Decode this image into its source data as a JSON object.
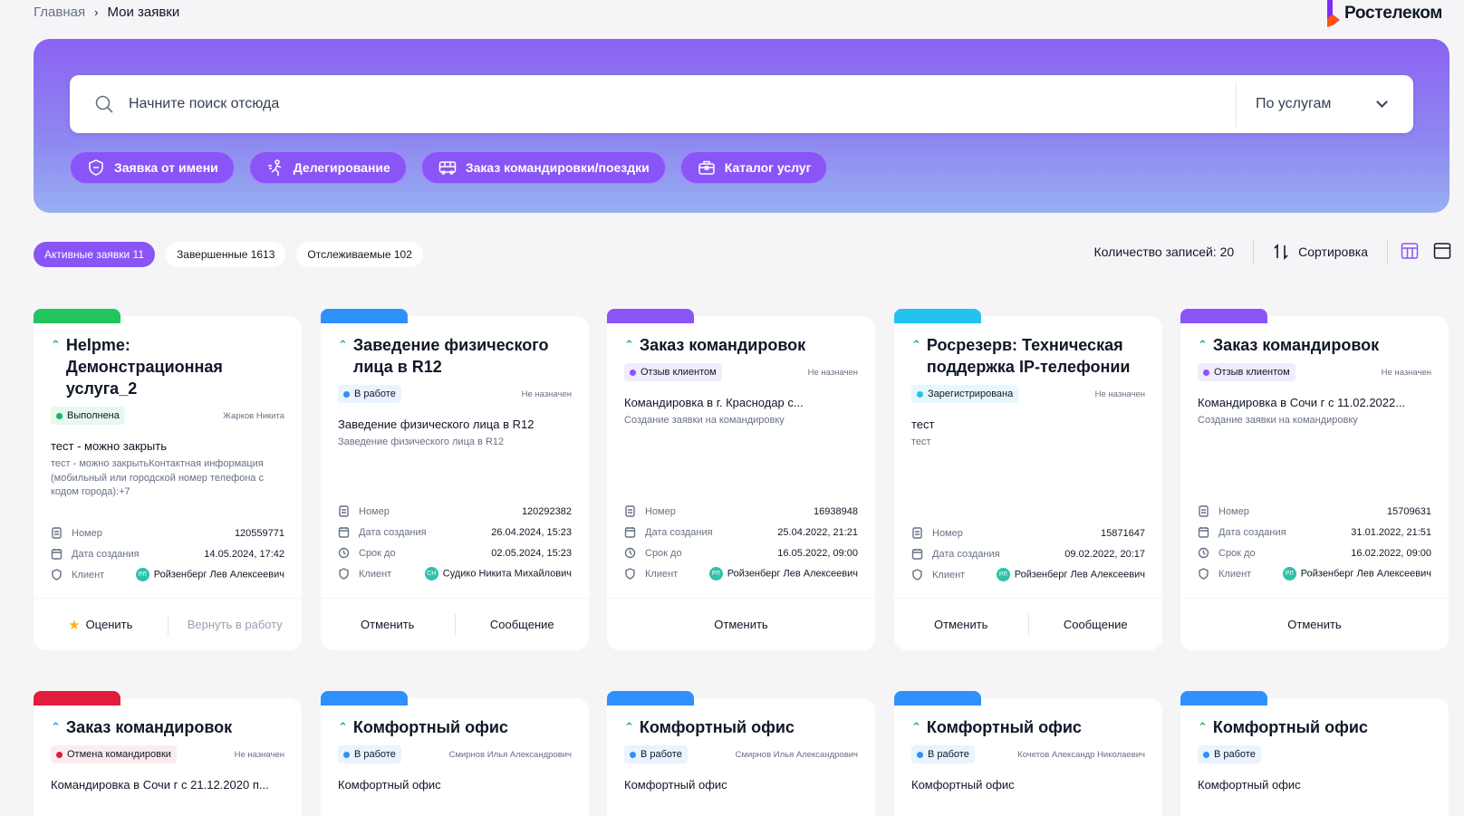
{
  "breadcrumb": {
    "home": "Главная",
    "current": "Мои заявки"
  },
  "logo": {
    "text": "Ростелеком"
  },
  "search": {
    "placeholder": "Начните поиск отсюда",
    "scope": "По услугам"
  },
  "actions": [
    {
      "label": "Заявка от имени",
      "icon": "shield-icon"
    },
    {
      "label": "Делегирование",
      "icon": "delegate-icon"
    },
    {
      "label": "Заказ командировки/поездки",
      "icon": "bus-icon"
    },
    {
      "label": "Каталог услуг",
      "icon": "briefcase-icon"
    }
  ],
  "tabs": [
    {
      "label": "Активные заявки 11",
      "active": true
    },
    {
      "label": "Завершенные 1613",
      "active": false
    },
    {
      "label": "Отслеживаемые 102",
      "active": false
    }
  ],
  "toolbar": {
    "count": "Количество записей: 20",
    "sort": "Сортировка"
  },
  "field_labels": {
    "number": "Номер",
    "created": "Дата создания",
    "due": "Срок до",
    "client": "Клиент"
  },
  "cards": [
    {
      "title": "Helpme: Демонстрационная услуга_2",
      "accent": "#22c55e",
      "status": "Выполнена",
      "status_color": "#12b76a",
      "status_bg": "#e7f8ee",
      "assignee": "Жарков Никита",
      "desc_title": "тест - можно закрыть",
      "desc_sub": "тест - можно закрытьКонтактная информация (мобильный или городской номер телефона с кодом города):+7",
      "number": "120559771",
      "created": "14.05.2024, 17:42",
      "due": "",
      "client_initials": "РЛ",
      "client": "Ройзенберг Лев Алексеевич",
      "buttons": [
        "Оценить",
        "Вернуть в работу"
      ]
    },
    {
      "title": "Заведение физического лица в R12",
      "accent": "#2e90fa",
      "status": "В работе",
      "status_color": "#2e90fa",
      "status_bg": "#eaf3fe",
      "assignee": "Не назначен",
      "desc_title": "Заведение физического лица в R12",
      "desc_sub": "Заведение физического лица в R12",
      "number": "120292382",
      "created": "26.04.2024, 15:23",
      "due": "02.05.2024, 15:23",
      "client_initials": "СН",
      "client": "Судико Никита Михайлович",
      "buttons": [
        "Отменить",
        "Сообщение"
      ]
    },
    {
      "title": "Заказ командировок",
      "accent": "#8a55f7",
      "status": "Отзыв клиентом",
      "status_color": "#8a55f7",
      "status_bg": "#f1ebfe",
      "assignee": "Не назначен",
      "desc_title": "Командировка в г. Краснодар с...",
      "desc_sub": "Создание заявки на командировку",
      "number": "16938948",
      "created": "25.04.2022, 21:21",
      "due": "16.05.2022, 09:00",
      "client_initials": "РЛ",
      "client": "Ройзенберг Лев Алексеевич",
      "buttons": [
        "Отменить"
      ]
    },
    {
      "title": "Росрезерв: Техническая поддержка IP-телефонии",
      "accent": "#22c3ee",
      "status": "Зарегистрирована",
      "status_color": "#22c3ee",
      "status_bg": "#e6f8fd",
      "assignee": "Не назначен",
      "desc_title": "тест",
      "desc_sub": "тест",
      "number": "15871647",
      "created": "09.02.2022, 20:17",
      "due": "",
      "client_initials": "РЛ",
      "client": "Ройзенберг Лев Алексеевич",
      "buttons": [
        "Отменить",
        "Сообщение"
      ]
    },
    {
      "title": "Заказ командировок",
      "accent": "#8a55f7",
      "status": "Отзыв клиентом",
      "status_color": "#8a55f7",
      "status_bg": "#f1ebfe",
      "assignee": "Не назначен",
      "desc_title": "Командировка в Сочи г с 11.02.2022...",
      "desc_sub": "Создание заявки на командировку",
      "number": "15709631",
      "created": "31.01.2022, 21:51",
      "due": "16.02.2022, 09:00",
      "client_initials": "РЛ",
      "client": "Ройзенберг Лев Алексеевич",
      "buttons": [
        "Отменить"
      ]
    },
    {
      "title": "Заказ командировок",
      "accent": "#e31b3c",
      "status": "Отмена командировки",
      "status_color": "#e31b3c",
      "status_bg": "#fdecee",
      "assignee": "Не назначен",
      "desc_title": "Командировка в Сочи г с 21.12.2020 п...",
      "priority_low": true
    },
    {
      "title": "Комфортный офис",
      "accent": "#2e90fa",
      "status": "В работе",
      "status_color": "#2e90fa",
      "status_bg": "#eaf3fe",
      "assignee": "Смирнов Илья Александрович",
      "desc_title": "Комфортный офис"
    },
    {
      "title": "Комфортный офис",
      "accent": "#2e90fa",
      "status": "В работе",
      "status_color": "#2e90fa",
      "status_bg": "#eaf3fe",
      "assignee": "Смирнов Илья Александрович",
      "desc_title": "Комфортный офис"
    },
    {
      "title": "Комфортный офис",
      "accent": "#2e90fa",
      "status": "В работе",
      "status_color": "#2e90fa",
      "status_bg": "#eaf3fe",
      "assignee": "Кочетов Александр Николаевич",
      "desc_title": "Комфортный офис"
    },
    {
      "title": "Комфортный офис",
      "accent": "#2e90fa",
      "status": "В работе",
      "status_color": "#2e90fa",
      "status_bg": "#eaf3fe",
      "assignee": "",
      "desc_title": "Комфортный офис"
    }
  ],
  "colors": {
    "brand": "#8a55f7",
    "accent_green": "#12b76a"
  }
}
